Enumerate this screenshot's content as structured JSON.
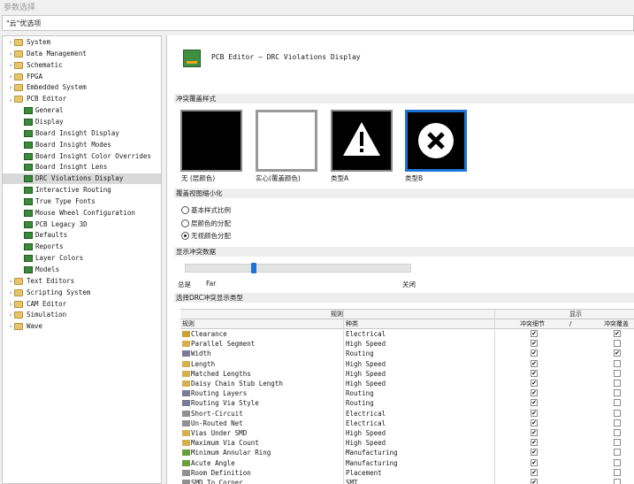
{
  "window": {
    "title": "参数选择"
  },
  "search": {
    "value": "\"云\"优选项"
  },
  "tree": {
    "items": [
      {
        "label": "System",
        "level": 0,
        "type": "folder",
        "expanded": false
      },
      {
        "label": "Data Management",
        "level": 0,
        "type": "folder",
        "expanded": false
      },
      {
        "label": "Schematic",
        "level": 0,
        "type": "folder",
        "expanded": false
      },
      {
        "label": "FPGA",
        "level": 0,
        "type": "folder",
        "expanded": false
      },
      {
        "label": "Embedded System",
        "level": 0,
        "type": "folder",
        "expanded": false
      },
      {
        "label": "PCB Editor",
        "level": 0,
        "type": "folder",
        "expanded": true
      },
      {
        "label": "General",
        "level": 1,
        "type": "leaf"
      },
      {
        "label": "Display",
        "level": 1,
        "type": "leaf"
      },
      {
        "label": "Board Insight Display",
        "level": 1,
        "type": "leaf"
      },
      {
        "label": "Board Insight Modes",
        "level": 1,
        "type": "leaf"
      },
      {
        "label": "Board Insight Color Overrides",
        "level": 1,
        "type": "leaf"
      },
      {
        "label": "Board Insight Lens",
        "level": 1,
        "type": "leaf"
      },
      {
        "label": "DRC Violations Display",
        "level": 1,
        "type": "leaf",
        "selected": true
      },
      {
        "label": "Interactive Routing",
        "level": 1,
        "type": "leaf"
      },
      {
        "label": "True Type Fonts",
        "level": 1,
        "type": "leaf"
      },
      {
        "label": "Mouse Wheel Configuration",
        "level": 1,
        "type": "leaf"
      },
      {
        "label": "PCB Legacy 3D",
        "level": 1,
        "type": "leaf"
      },
      {
        "label": "Defaults",
        "level": 1,
        "type": "leaf"
      },
      {
        "label": "Reports",
        "level": 1,
        "type": "leaf"
      },
      {
        "label": "Layer Colors",
        "level": 1,
        "type": "leaf"
      },
      {
        "label": "Models",
        "level": 1,
        "type": "leaf"
      },
      {
        "label": "Text Editors",
        "level": 0,
        "type": "folder",
        "expanded": false
      },
      {
        "label": "Scripting System",
        "level": 0,
        "type": "folder",
        "expanded": false
      },
      {
        "label": "CAM Editor",
        "level": 0,
        "type": "folder",
        "expanded": false
      },
      {
        "label": "Simulation",
        "level": 0,
        "type": "folder",
        "expanded": false
      },
      {
        "label": "Wave",
        "level": 0,
        "type": "folder",
        "expanded": false
      }
    ]
  },
  "main": {
    "title": "PCB Editor – DRC Violations Display",
    "overlay_section": "冲突覆盖样式",
    "swatches": [
      {
        "label": "无 (层颜色)",
        "icon": "none-icon",
        "selected": false
      },
      {
        "label": "实心(覆盖颜色)",
        "icon": "solid-icon",
        "selected": false
      },
      {
        "label": "类型A",
        "icon": "warning-icon",
        "selected": false
      },
      {
        "label": "类型B",
        "icon": "close-circle-icon",
        "selected": true
      }
    ],
    "zoom_section": "覆盖视图缩小化",
    "radios": [
      {
        "label": "基本样式比例",
        "checked": false
      },
      {
        "label": "层颜色的分配",
        "checked": false
      },
      {
        "label": "无视颜色分配",
        "checked": true
      }
    ],
    "display_section": "显示冲突数据",
    "slider": {
      "value": 0.3,
      "left_label": "总是",
      "mid_label": "Far",
      "right_label": "关闭"
    },
    "types_section": "选择DRC冲突显示类型",
    "table": {
      "group_rules": "规则",
      "group_display": "显示",
      "col_rule": "规则",
      "col_kind": "种类",
      "col_detail": "冲突细节",
      "col_sep": "/",
      "col_overlay": "冲突覆盖",
      "accent": "#1e73d6",
      "rows": [
        {
          "name": "Clearance",
          "kind": "Electrical",
          "detail": true,
          "overlay": true
        },
        {
          "name": "Parallel Segment",
          "kind": "High Speed",
          "detail": true,
          "overlay": false
        },
        {
          "name": "Width",
          "kind": "Routing",
          "detail": true,
          "overlay": true
        },
        {
          "name": "Length",
          "kind": "High Speed",
          "detail": true,
          "overlay": false
        },
        {
          "name": "Matched Lengths",
          "kind": "High Speed",
          "detail": true,
          "overlay": false
        },
        {
          "name": "Daisy Chain Stub Length",
          "kind": "High Speed",
          "detail": true,
          "overlay": false
        },
        {
          "name": "Routing Layers",
          "kind": "Routing",
          "detail": true,
          "overlay": false
        },
        {
          "name": "Routing Via Style",
          "kind": "Routing",
          "detail": true,
          "overlay": false
        },
        {
          "name": "Short-Circuit",
          "kind": "Electrical",
          "detail": true,
          "overlay": false
        },
        {
          "name": "Un-Routed Net",
          "kind": "Electrical",
          "detail": true,
          "overlay": false
        },
        {
          "name": "Vias Under SMD",
          "kind": "High Speed",
          "detail": true,
          "overlay": false
        },
        {
          "name": "Maximum Via Count",
          "kind": "High Speed",
          "detail": true,
          "overlay": false
        },
        {
          "name": "Minimum Annular Ring",
          "kind": "Manufacturing",
          "detail": true,
          "overlay": false
        },
        {
          "name": "Acute Angle",
          "kind": "Manufacturing",
          "detail": true,
          "overlay": false
        },
        {
          "name": "Room Definition",
          "kind": "Placement",
          "detail": true,
          "overlay": false
        },
        {
          "name": "SMD To Corner",
          "kind": "SMT",
          "detail": true,
          "overlay": false
        }
      ]
    }
  }
}
